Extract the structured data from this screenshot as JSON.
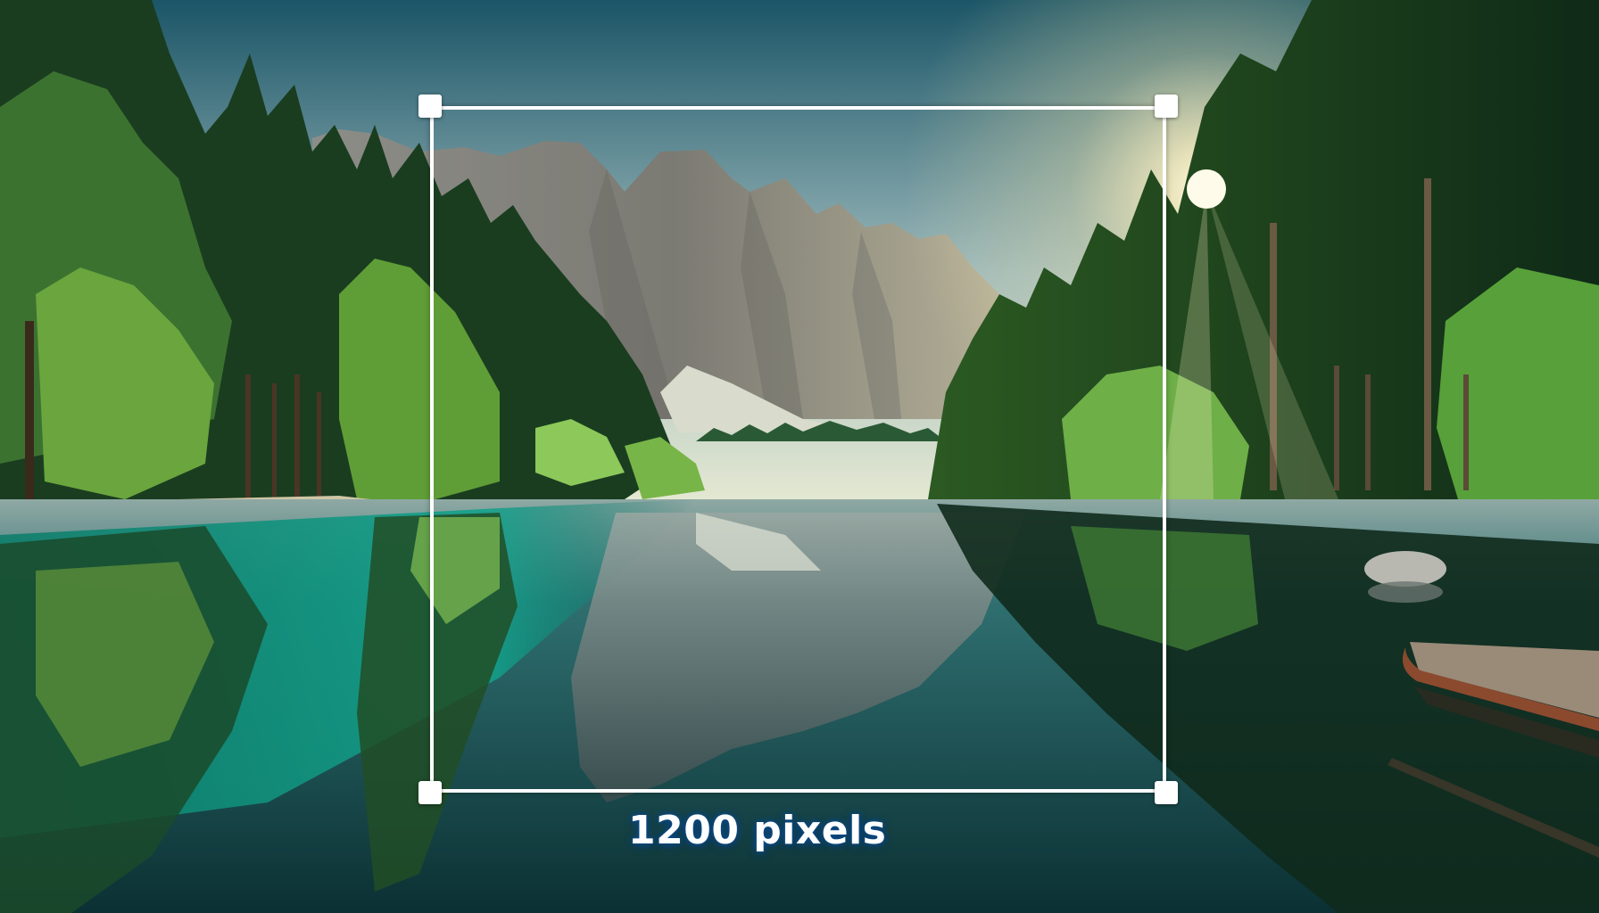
{
  "canvas": {
    "image_description_icon": "landscape-photo",
    "colors": {
      "sky_top": "#1d5a6c",
      "sky_horizon": "#dfe6cf",
      "mountain": "#8e8b84",
      "forest_dark": "#173a1f",
      "forest_mid": "#2f6b2c",
      "foliage_light": "#7fc24a",
      "water_turquoise": "#0f8c7c",
      "water_deep": "#0d3437",
      "sun": "#fff6d2"
    }
  },
  "crop_overlay": {
    "dimension_label": "1200 pixels",
    "frame_color": "#ffffff",
    "label_glow_color": "#0b4a8a"
  }
}
